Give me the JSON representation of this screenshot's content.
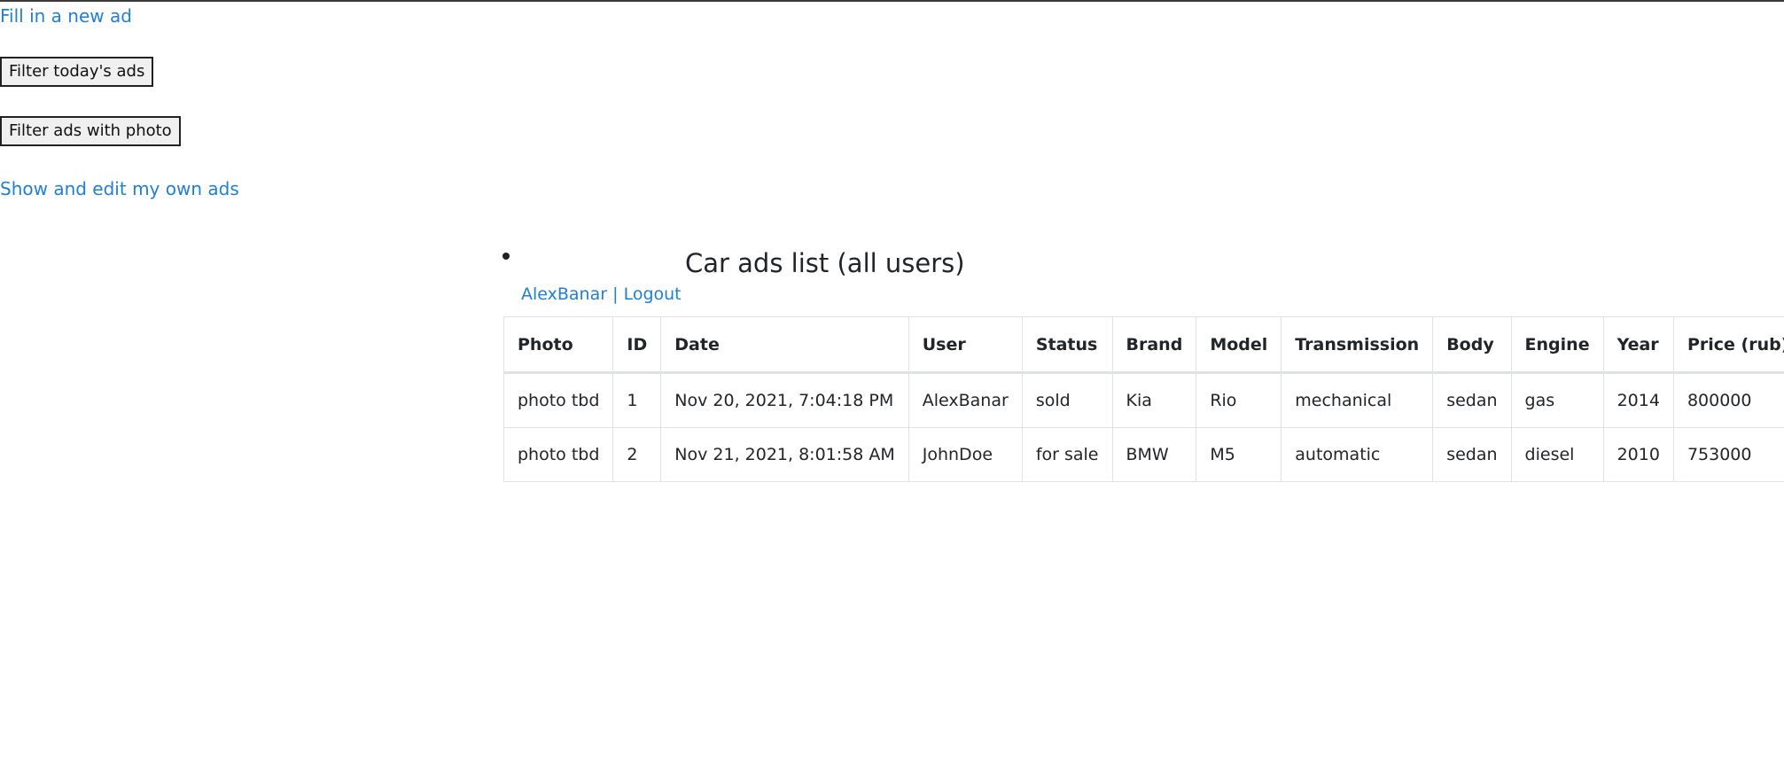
{
  "nav": {
    "new_ad_link": "Fill in a new ad",
    "filter_today_button": "Filter today's ads",
    "filter_photo_button": "Filter ads with photo",
    "my_ads_link": "Show and edit my own ads"
  },
  "main": {
    "title": "Car ads list (all users)",
    "user": {
      "name": "AlexBanar",
      "separator": "|",
      "logout": "Logout"
    },
    "table": {
      "columns": [
        "Photo",
        "ID",
        "Date",
        "User",
        "Status",
        "Brand",
        "Model",
        "Transmission",
        "Body",
        "Engine",
        "Year",
        "Price (rub)"
      ],
      "rows": [
        {
          "photo": "photo tbd",
          "id": "1",
          "date": "Nov 20, 2021, 7:04:18 PM",
          "user": "AlexBanar",
          "status": "sold",
          "brand": "Kia",
          "model": "Rio",
          "transmission": "mechanical",
          "body": "sedan",
          "engine": "gas",
          "year": "2014",
          "price": "800000"
        },
        {
          "photo": "photo tbd",
          "id": "2",
          "date": "Nov 21, 2021, 8:01:58 AM",
          "user": "JohnDoe",
          "status": "for sale",
          "brand": "BMW",
          "model": "M5",
          "transmission": "automatic",
          "body": "sedan",
          "engine": "diesel",
          "year": "2010",
          "price": "753000"
        }
      ]
    }
  },
  "colors": {
    "link": "#1f7fd6",
    "text": "#212529",
    "table_border": "#dee2e6"
  }
}
